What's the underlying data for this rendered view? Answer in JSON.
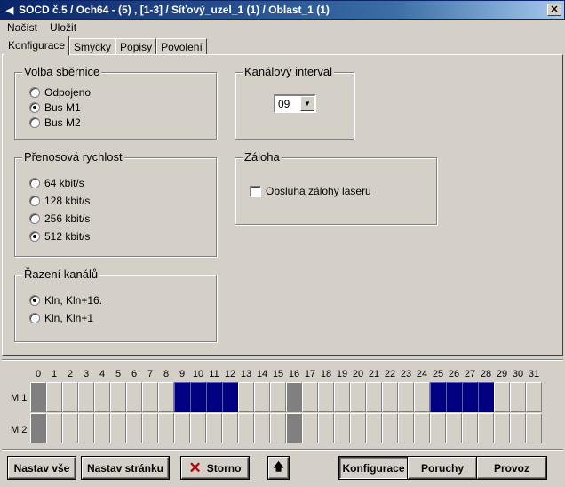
{
  "window": {
    "title": "SOCD č.5 / Och64 - (5) , [1-3] / Síťový_uzel_1 (1) / Oblast_1 (1)",
    "close_glyph": "✕"
  },
  "menu": [
    "Načíst",
    "Uložit"
  ],
  "tabs": [
    "Konfigurace",
    "Smyčky",
    "Popisy",
    "Povolení"
  ],
  "groups": {
    "bus": {
      "title": "Volba sběrnice",
      "options": [
        "Odpojeno",
        "Bus M1",
        "Bus M2"
      ],
      "selected": 1
    },
    "speed": {
      "title": "Přenosová rychlost",
      "options": [
        "64 kbit/s",
        "128 kbit/s",
        "256 kbit/s",
        "512 kbit/s"
      ],
      "selected": 3
    },
    "order": {
      "title": "Řazení kanálů",
      "options": [
        "Kln, Kln+16.",
        "Kln, Kln+1"
      ],
      "selected": 0
    },
    "interval": {
      "title": "Kanálový interval",
      "value": "09"
    },
    "backup": {
      "title": "Záloha",
      "checkbox_label": "Obsluha zálohy laseru",
      "checked": false
    }
  },
  "channel_grid": {
    "numbers": [
      "0",
      "1",
      "2",
      "3",
      "4",
      "5",
      "6",
      "7",
      "8",
      "9",
      "10",
      "11",
      "12",
      "13",
      "14",
      "15",
      "16",
      "17",
      "18",
      "19",
      "20",
      "21",
      "22",
      "23",
      "24",
      "25",
      "26",
      "27",
      "28",
      "29",
      "30",
      "31"
    ],
    "rows": [
      "M 1",
      "M 2"
    ],
    "m1_selected": [
      9,
      10,
      11,
      12,
      25,
      26,
      27,
      28
    ],
    "m2_selected": [],
    "edge_channels": [
      0,
      16
    ],
    "colors": {
      "selected": "#000080",
      "edge": "#808080"
    }
  },
  "buttons": {
    "set_all": "Nastav vše",
    "set_page": "Nastav stránku",
    "cancel": "Storno",
    "up_glyph": "🡅",
    "konfigurace": "Konfigurace",
    "poruchy": "Poruchy",
    "provoz": "Provoz"
  }
}
